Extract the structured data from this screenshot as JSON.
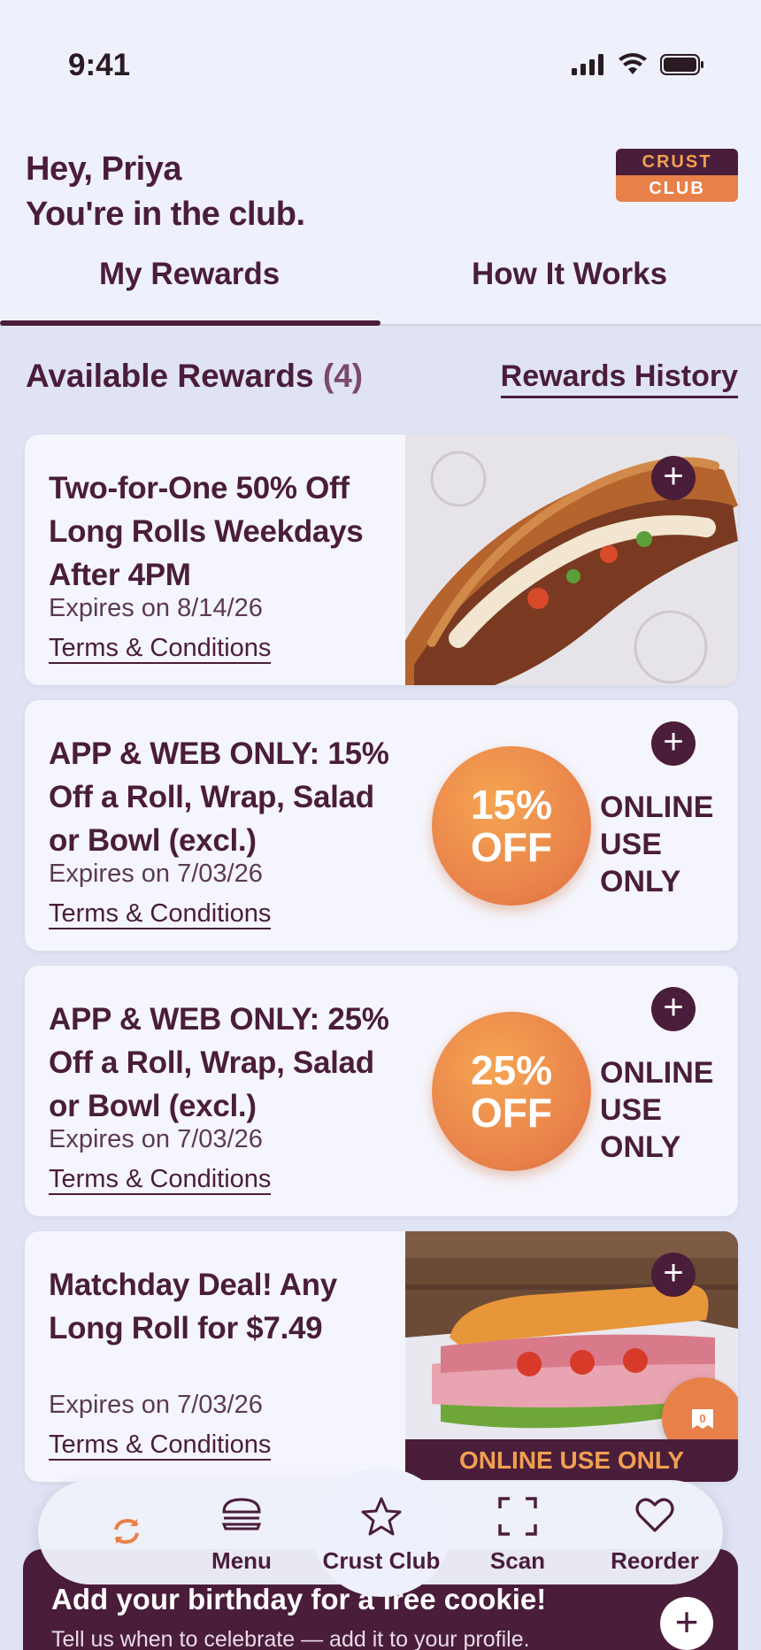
{
  "status_bar": {
    "time": "9:41"
  },
  "header": {
    "greeting_line1": "Hey, Priya",
    "greeting_line2": "You're in the club.",
    "logo_top": "CRUST",
    "logo_bottom": "CLUB"
  },
  "tabs": [
    {
      "label": "My Rewards",
      "active": true
    },
    {
      "label": "How It Works",
      "active": false
    }
  ],
  "rewards_section": {
    "title": "Available Rewards",
    "count": "(4)",
    "history_link": "Rewards History"
  },
  "rewards": [
    {
      "title": "Two-for-One 50% Off Long Rolls Weekdays After 4PM",
      "expires": "Expires on 8/14/26",
      "terms": "Terms & Conditions",
      "media": "long-roll-photo"
    },
    {
      "title": "APP & WEB ONLY: 15% Off a Roll, Wrap, Salad or Bowl (excl.)",
      "expires": "Expires on 7/03/26",
      "terms": "Terms & Conditions",
      "badge_line1": "15%",
      "badge_line2": "OFF",
      "online_line1": "ONLINE",
      "online_line2": "USE ONLY"
    },
    {
      "title": "APP & WEB ONLY: 25% Off a Roll, Wrap, Salad or Bowl (excl.)",
      "expires": "Expires on 7/03/26",
      "terms": "Terms & Conditions",
      "badge_line1": "25%",
      "badge_line2": "OFF",
      "online_line1": "ONLINE",
      "online_line2": "USE ONLY"
    },
    {
      "title": "Matchday Deal! Any Long Roll for $7.49",
      "expires": "Expires on 7/03/26",
      "terms": "Terms & Conditions",
      "banner": "ONLINE USE ONLY",
      "bubble_count": "0"
    }
  ],
  "nav": [
    {
      "label": "",
      "icon": "refresh-icon"
    },
    {
      "label": "Menu",
      "icon": "burger-icon"
    },
    {
      "label": "Crust Club",
      "icon": "star-icon",
      "active": true
    },
    {
      "label": "Scan",
      "icon": "scan-icon"
    },
    {
      "label": "Reorder",
      "icon": "heart-icon"
    }
  ],
  "promo": {
    "title": "Add your birthday for a free cookie!",
    "subtitle": "Tell us when to celebrate — add it to your profile."
  },
  "colors": {
    "brand_plum": "#4a1d3a",
    "brand_orange": "#e8804a",
    "background": "#dfe3f3"
  }
}
